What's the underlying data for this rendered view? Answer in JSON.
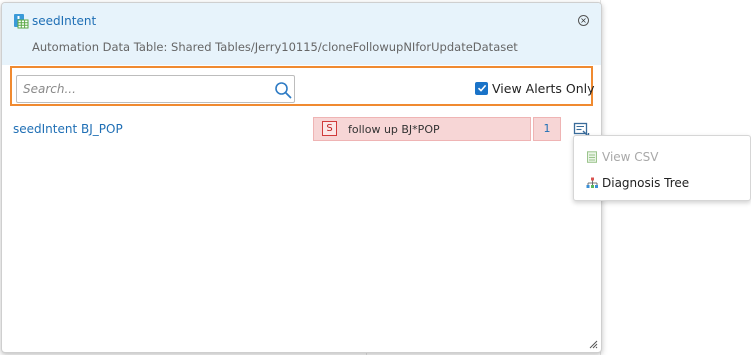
{
  "popup": {
    "title": "seedIntent",
    "subtitle": "Automation Data Table: Shared Tables/Jerry10115/cloneFollowupNIforUpdateDataset",
    "close_symbol": "×"
  },
  "toolbar": {
    "search_placeholder": "Search...",
    "search_value": "",
    "view_alerts_only_label": "View Alerts Only",
    "view_alerts_only_checked": true
  },
  "results": [
    {
      "name": "seedIntent BJ_POP",
      "badge": "S",
      "intent": "follow up BJ*POP",
      "count": "1"
    }
  ],
  "context_menu": {
    "items": [
      {
        "label": "View CSV",
        "icon": "csv-file-icon",
        "enabled": false
      },
      {
        "label": "Diagnosis Tree",
        "icon": "tree-icon",
        "enabled": true
      }
    ]
  },
  "colors": {
    "accent_blue": "#1f6fb5",
    "header_bg": "#e7f3fb",
    "highlight_orange": "#f08a30",
    "alert_row_bg": "#f7d6d6",
    "checkbox_blue": "#1a73c8"
  }
}
